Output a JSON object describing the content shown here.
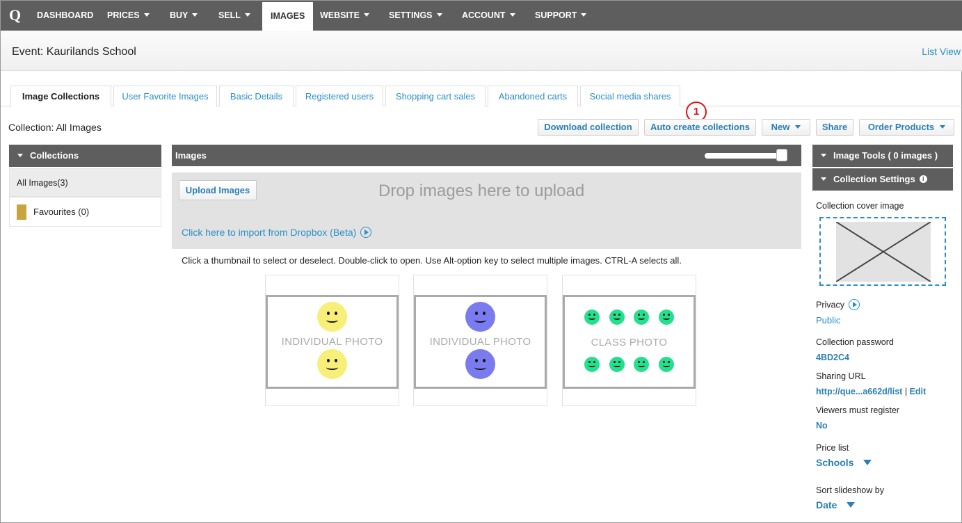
{
  "nav": {
    "logo": "Q",
    "items": [
      {
        "label": "DASHBOARD"
      },
      {
        "label": "PRICES"
      },
      {
        "label": "BUY"
      },
      {
        "label": "SELL"
      },
      {
        "label": "IMAGES"
      },
      {
        "label": "WEBSITE"
      },
      {
        "label": "SETTINGS"
      },
      {
        "label": "ACCOUNT"
      },
      {
        "label": "SUPPORT"
      }
    ]
  },
  "header": {
    "title": "Event: Kaurilands School",
    "list_view": "List View"
  },
  "tabs": [
    {
      "label": "Image Collections"
    },
    {
      "label": "User Favorite Images"
    },
    {
      "label": "Basic Details"
    },
    {
      "label": "Registered users"
    },
    {
      "label": "Shopping cart sales"
    },
    {
      "label": "Abandoned carts"
    },
    {
      "label": "Social media shares"
    }
  ],
  "toolbar": {
    "collection_label": "Collection: All Images",
    "download": "Download collection",
    "auto_create": "Auto create collections",
    "new": "New",
    "share": "Share",
    "order_products": "Order Products",
    "callout": "1"
  },
  "collections": {
    "heading": "Collections",
    "items": [
      {
        "label": "All Images(3)"
      },
      {
        "label": "Favourites (0)",
        "color": "#c8a43c"
      }
    ]
  },
  "images": {
    "heading": "Images",
    "zoom_level": 0.9,
    "upload_label": "Upload Images",
    "drop_text": "Drop images here to upload",
    "dropbox_link": "Click here to import from Dropbox (Beta)",
    "hint": "Click a thumbnail to select or deselect. Double-click to open. Use Alt-option key to select multiple images. CTRL-A selects all.",
    "thumbnails": [
      {
        "label": "INDIVIDUAL PHOTO",
        "face_color": "#f7ef7a"
      },
      {
        "label": "INDIVIDUAL PHOTO",
        "face_color": "#7b7bf0"
      },
      {
        "label": "CLASS PHOTO",
        "face_color": "#22e08e"
      }
    ]
  },
  "right_panel": {
    "image_tools": "Image Tools ( 0 images )",
    "collection_settings": "Collection Settings",
    "info_icon": "i",
    "cover_label": "Collection cover image",
    "privacy_label": "Privacy",
    "privacy_value": "Public",
    "password_label": "Collection password",
    "password_value": "4BD2C4",
    "sharing_label": "Sharing URL",
    "sharing_value": "http://que...a662d/list",
    "sharing_sep": "|",
    "sharing_edit": "Edit",
    "register_label": "Viewers must register",
    "register_value": "No",
    "price_label": "Price list",
    "price_value": "Schools",
    "sort_label": "Sort slideshow by",
    "sort_value": "Date"
  }
}
